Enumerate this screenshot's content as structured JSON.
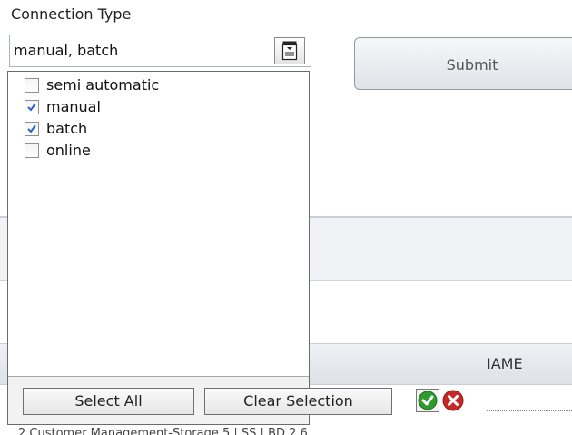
{
  "field": {
    "label": "Connection Type",
    "value": "manual, batch"
  },
  "submit": {
    "label": "Submit"
  },
  "options": [
    {
      "label": "semi automatic",
      "checked": false
    },
    {
      "label": "manual",
      "checked": true
    },
    {
      "label": "batch",
      "checked": true
    },
    {
      "label": "online",
      "checked": false
    }
  ],
  "footer": {
    "select_all": "Select All",
    "clear_selection": "Clear Selection"
  },
  "background": {
    "column_header_fragment": "IAME",
    "bottom_row_fragment": "2   Customer Management-Storage 5 | SS | BD 2.6"
  },
  "icons": {
    "combo_button": "dropdown-list-icon",
    "confirm": "check-circle-icon",
    "cancel": "close-circle-icon"
  },
  "colors": {
    "check": "#2a63c9",
    "confirm": "#2e9b2e",
    "cancel": "#c62828"
  }
}
